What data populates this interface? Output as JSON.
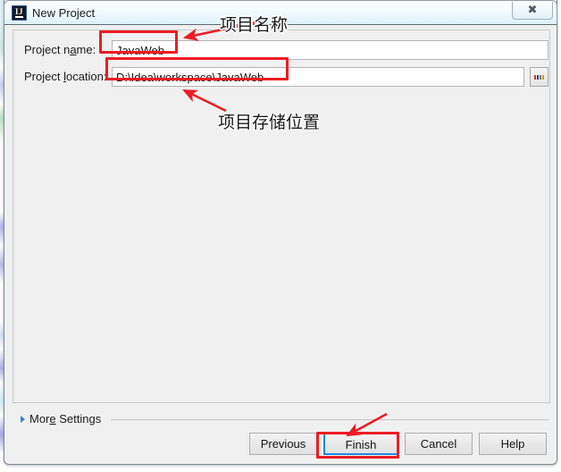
{
  "window": {
    "title": "New Project",
    "icon": "intellij-idea-icon",
    "close_label": "✕"
  },
  "form": {
    "fields": [
      {
        "label_before": "Project n",
        "label_mnemonic": "a",
        "label_after": "me:",
        "label_full": "Project name:",
        "value": "JavaWeb",
        "placeholder": ""
      },
      {
        "label_before": "Project ",
        "label_mnemonic": "l",
        "label_after": "ocation:",
        "label_full": "Project location:",
        "value": "D:\\Idea\\workspace\\JavaWeb",
        "placeholder": "",
        "browse_label": "..."
      }
    ]
  },
  "more_settings": {
    "label_before": "Mor",
    "label_mnemonic": "e",
    "label_after": " Settings",
    "label_full": "More Settings",
    "expanded": false
  },
  "footer": {
    "buttons": [
      {
        "label": "Previous",
        "focused": false
      },
      {
        "label": "Finish",
        "focused": true
      },
      {
        "label": "Cancel",
        "focused": false
      },
      {
        "label": "Help",
        "focused": false
      }
    ]
  },
  "annotations": {
    "color": "#ec1c24",
    "notes": [
      {
        "text": "项目名称"
      },
      {
        "text": "项目存储位置"
      }
    ],
    "highlight_boxes": [
      {
        "target": "project-name-input"
      },
      {
        "target": "project-location-input"
      },
      {
        "target": "finish-button"
      }
    ]
  }
}
